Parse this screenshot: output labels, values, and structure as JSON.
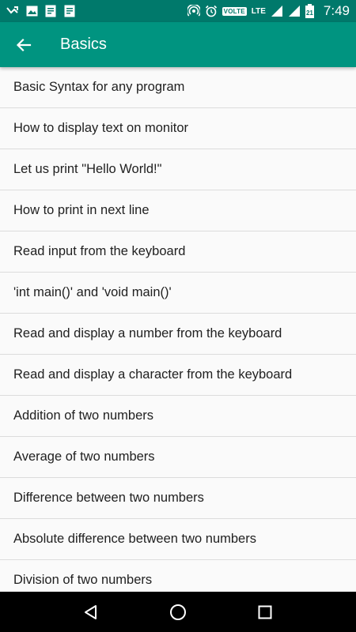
{
  "status_bar": {
    "time": "7:49",
    "volte": "VOLTE",
    "network": "LTE",
    "battery_level": "21"
  },
  "app_bar": {
    "title": "Basics"
  },
  "list": {
    "items": [
      "Basic Syntax for any program",
      "How to display text on monitor",
      "Let us print \"Hello World!\"",
      "How to print in next line",
      "Read input from the keyboard",
      "'int main()' and 'void main()'",
      "Read and display a number from the keyboard",
      "Read and display a character from the keyboard",
      "Addition of two numbers",
      "Average of two numbers",
      "Difference between two numbers",
      "Absolute difference between two numbers",
      "Division of two numbers"
    ]
  },
  "colors": {
    "status_bar": "#00796b",
    "app_bar": "#009480",
    "background": "#fafafa",
    "text": "#212121",
    "divider": "#dcdcdc"
  },
  "icons": {
    "status_left": [
      "missed-call-icon",
      "image-icon",
      "document-icon",
      "document-icon"
    ],
    "status_right": [
      "hotspot-icon",
      "alarm-icon",
      "signal-icon",
      "signal-icon",
      "battery-icon"
    ],
    "back": "arrow-back-icon",
    "nav": [
      "back-triangle-icon",
      "home-circle-icon",
      "recents-square-icon"
    ]
  }
}
